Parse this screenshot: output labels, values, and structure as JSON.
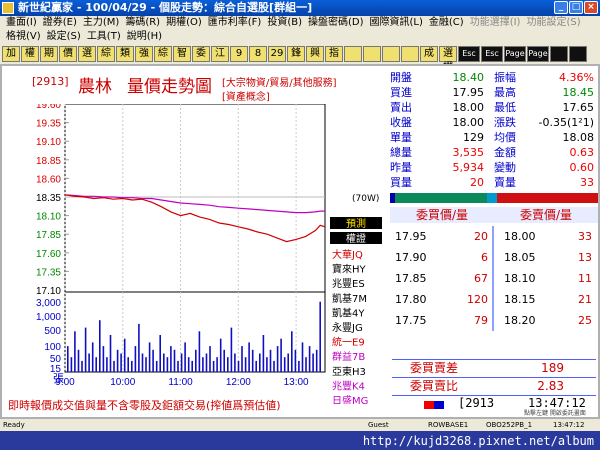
{
  "window": {
    "title": "新世紀贏家 - 100/04/29 - 個股走勢：綜合自選股[群組一]"
  },
  "menu": {
    "row1": [
      "畫面(I)",
      "證券(E)",
      "主力(M)",
      "籌碼(R)",
      "期權(O)",
      "匯市利率(F)",
      "投資(B)",
      "操盤密碼(D)",
      "國際資訊(L)",
      "金融(C)",
      "功能選擇(I)",
      "功能設定(S)"
    ],
    "row2": [
      "格視(V)",
      "設定(S)",
      "工具(T)",
      "說明(H)"
    ]
  },
  "toolbar": {
    "buttons": [
      "加",
      "權",
      "期",
      "價",
      "選",
      "綜",
      "類",
      "強",
      "綜",
      "智",
      "委",
      "江",
      "9",
      "8",
      "29",
      "鋒",
      "興",
      "指",
      "",
      "",
      "",
      "",
      "成",
      "選擇",
      "Esc",
      "Esc",
      "Page Up",
      "Page Down",
      "",
      ""
    ]
  },
  "stock": {
    "code": "[2913]",
    "name": "農林",
    "chart_title": "量價走勢圖",
    "category": "[大宗物資/貿易/其他服務]",
    "category2": "[資產概念]"
  },
  "chart_data": {
    "type": "line",
    "price_ticks": [
      "19.60",
      "19.35",
      "19.10",
      "18.85",
      "18.60",
      "18.35",
      "18.10",
      "17.85",
      "17.60",
      "17.35",
      "17.10"
    ],
    "volume_ticks": [
      "3,000",
      "1,000",
      "500",
      "100",
      "50",
      "15"
    ],
    "volume_unit": "張",
    "x_ticks": [
      "9:00",
      "10:00",
      "11:00",
      "12:00",
      "13:00"
    ],
    "ylim": [
      17.1,
      19.6
    ],
    "ref_price": 18.35,
    "price_x_minutes": [
      0,
      10,
      20,
      30,
      40,
      50,
      60,
      70,
      80,
      90,
      100,
      110,
      120,
      130,
      140,
      150,
      160,
      170,
      180,
      190,
      200,
      210,
      220,
      230,
      240,
      250,
      260,
      265,
      270
    ],
    "price_y": [
      18.38,
      18.36,
      18.35,
      18.33,
      18.34,
      18.32,
      18.33,
      18.31,
      18.32,
      18.28,
      18.22,
      18.15,
      18.1,
      18.13,
      18.08,
      18.05,
      18.0,
      17.98,
      17.95,
      17.92,
      17.88,
      17.85,
      17.8,
      17.75,
      17.78,
      17.82,
      17.9,
      17.97,
      17.95
    ],
    "avg_y": [
      18.38,
      18.37,
      18.36,
      18.36,
      18.35,
      18.35,
      18.34,
      18.34,
      18.33,
      18.33,
      18.31,
      18.29,
      18.27,
      18.26,
      18.25,
      18.24,
      18.22,
      18.21,
      18.2,
      18.19,
      18.18,
      18.17,
      18.16,
      18.15,
      18.14,
      18.14,
      18.15,
      18.16,
      18.16
    ],
    "volume_level": [
      0.35,
      0.2,
      0.55,
      0.3,
      0.15,
      0.6,
      0.25,
      0.4,
      0.2,
      0.7,
      0.35,
      0.2,
      0.5,
      0.15,
      0.3,
      0.25,
      0.45,
      0.2,
      0.15,
      0.35,
      0.65,
      0.25,
      0.2,
      0.4,
      0.3,
      0.15,
      0.5,
      0.25,
      0.2,
      0.35,
      0.3,
      0.15,
      0.25,
      0.4,
      0.2,
      0.15,
      0.3,
      0.55,
      0.2,
      0.25,
      0.35,
      0.15,
      0.2,
      0.45,
      0.3,
      0.2,
      0.6,
      0.25,
      0.15,
      0.35,
      0.2,
      0.4,
      0.3,
      0.15,
      0.25,
      0.5,
      0.2,
      0.3,
      0.15,
      0.35,
      0.45,
      0.2,
      0.25,
      0.55,
      0.3,
      0.15,
      0.4,
      0.2,
      0.35,
      0.25,
      0.3,
      0.95
    ]
  },
  "legend": {
    "tag": "(70W)",
    "forecast": "預測",
    "sign": "權證",
    "brokers": [
      {
        "label": "大華JQ",
        "color": "#d00000"
      },
      {
        "label": "寶來HY",
        "color": "#000000"
      },
      {
        "label": "兆豐ES",
        "color": "#000000"
      },
      {
        "label": "凱基7M",
        "color": "#000000"
      },
      {
        "label": "凱基4Y",
        "color": "#000000"
      },
      {
        "label": "永豐JG",
        "color": "#000000"
      },
      {
        "label": "統一E9",
        "color": "#d00000"
      },
      {
        "label": "群益7B",
        "color": "#c000c0"
      },
      {
        "label": "亞東H3",
        "color": "#000000"
      },
      {
        "label": "兆豐K4",
        "color": "#c000c0"
      },
      {
        "label": "日盛MG",
        "color": "#c000c0"
      },
      {
        "label": "·····",
        "color": "#c000c0"
      }
    ]
  },
  "quote": [
    {
      "l1": "開盤",
      "v1": "18.40",
      "c1": "grn",
      "l2": "振幅",
      "v2": "4.36%",
      "c2": "red"
    },
    {
      "l1": "買進",
      "v1": "17.95",
      "c1": "blk",
      "l2": "最高",
      "v2": "18.45",
      "c2": "grn"
    },
    {
      "l1": "賣出",
      "v1": "18.00",
      "c1": "blk",
      "l2": "最低",
      "v2": "17.65",
      "c2": "blk"
    },
    {
      "l1": "收盤",
      "v1": "18.00",
      "c1": "blk",
      "l2": "漲跌",
      "v2": "-0.35(1²1)",
      "c2": "blk"
    },
    {
      "l1": "單量",
      "v1": "129",
      "c1": "blk",
      "l2": "均價",
      "v2": "18.08",
      "c2": "blk"
    },
    {
      "l1": "總量",
      "v1": "3,535",
      "c1": "red",
      "l2": "金額",
      "v2": "0.63",
      "c2": "red"
    },
    {
      "l1": "昨量",
      "v1": "5,934",
      "c1": "red",
      "l2": "變動",
      "v2": "0.60",
      "c2": "red"
    },
    {
      "l1": "買量",
      "v1": "20",
      "c1": "red",
      "l2": "賣量",
      "v2": "33",
      "c2": "red"
    }
  ],
  "orderbook": {
    "bid_header": "委買價/量",
    "ask_header": "委賣價/量",
    "rows": [
      {
        "bp": "17.95",
        "bq": "20",
        "ap": "18.00",
        "aq": "33"
      },
      {
        "bp": "17.90",
        "bq": "6",
        "ap": "18.05",
        "aq": "13"
      },
      {
        "bp": "17.85",
        "bq": "67",
        "ap": "18.10",
        "aq": "11"
      },
      {
        "bp": "17.80",
        "bq": "120",
        "ap": "18.15",
        "aq": "21"
      },
      {
        "bp": "17.75",
        "bq": "79",
        "ap": "18.20",
        "aq": "25"
      }
    ],
    "diff_label": "委買賣差",
    "diff_value": "189",
    "ratio_label": "委買賣比",
    "ratio_value": "2.83"
  },
  "footer": {
    "notice": "即時報價成交值與量不含零股及鉅額交易(搾値爲預估値)",
    "code": "[2913",
    "time": "13:47:12",
    "sub": "點擊左鍵 開啟委託畫面"
  },
  "status": {
    "ready": "Ready",
    "guest": "Guest",
    "base": "ROWBASE1",
    "code": "OBO252PB_1",
    "time": "13:47:12"
  },
  "watermark": "http://kujd3268.pixnet.net/album"
}
